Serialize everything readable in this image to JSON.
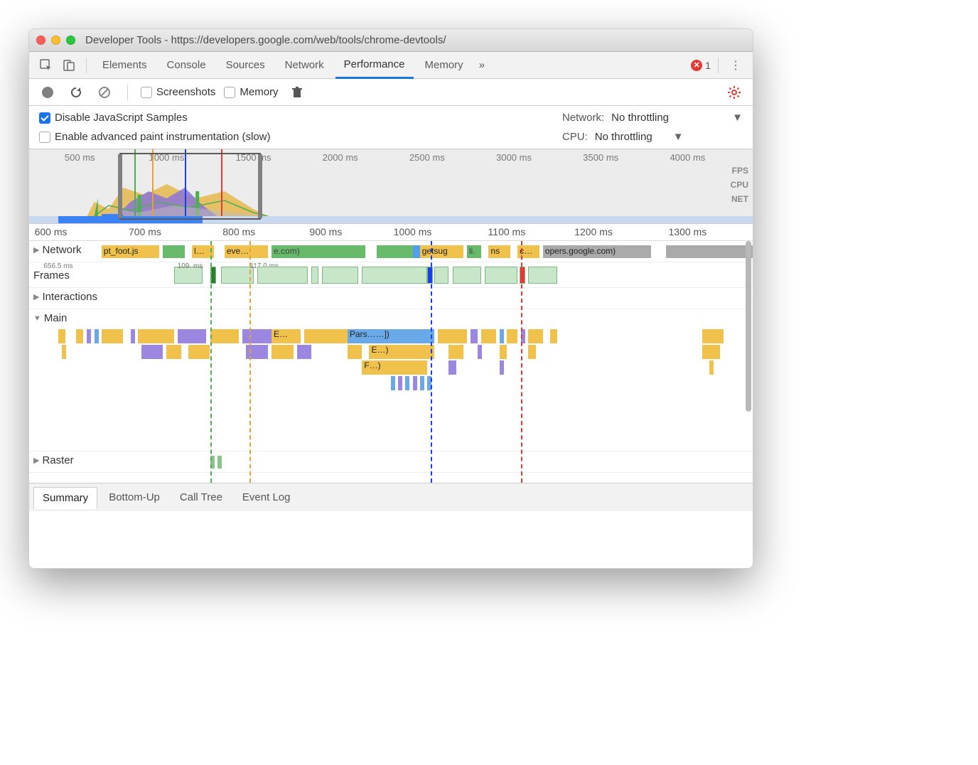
{
  "window": {
    "title": "Developer Tools - https://developers.google.com/web/tools/chrome-devtools/"
  },
  "tabs": {
    "elements": "Elements",
    "console": "Console",
    "sources": "Sources",
    "network": "Network",
    "performance": "Performance",
    "memory": "Memory",
    "active": "Performance",
    "more_glyph": "»",
    "error_count": "1"
  },
  "toolbar": {
    "screenshots": "Screenshots",
    "memory": "Memory"
  },
  "settings": {
    "disable_js_samples": "Disable JavaScript Samples",
    "enable_paint": "Enable advanced paint instrumentation (slow)",
    "network_label": "Network:",
    "network_value": "No throttling",
    "cpu_label": "CPU:",
    "cpu_value": "No throttling"
  },
  "overview": {
    "ticks": [
      "500 ms",
      "1000 ms",
      "1500 ms",
      "2000 ms",
      "2500 ms",
      "3000 ms",
      "3500 ms",
      "4000 ms"
    ],
    "labels": {
      "fps": "FPS",
      "cpu": "CPU",
      "net": "NET"
    }
  },
  "ruler": {
    "ticks": [
      "600 ms",
      "700 ms",
      "800 ms",
      "900 ms",
      "1000 ms",
      "1100 ms",
      "1200 ms",
      "1300 ms"
    ]
  },
  "tracks": {
    "network": "Network",
    "frames": "Frames",
    "interactions": "Interactions",
    "main": "Main",
    "raster": "Raster",
    "net_items": {
      "a": "pt_foot.js",
      "b": "l…",
      "c": "eve…",
      "d": "e.com)",
      "e": "getsug",
      "f": "li.",
      "g": "ns",
      "h": "c…",
      "i": "opers.google.com)"
    },
    "frame_meta": {
      "t0": "656.5 ms",
      "t1": "109. ms",
      "t2": "117.0 ms"
    },
    "main_items": {
      "e": "E…",
      "pars": "Pars……])",
      "e2": "E…)",
      "f": "F…)"
    }
  },
  "bottom_tabs": {
    "summary": "Summary",
    "bottom_up": "Bottom-Up",
    "call_tree": "Call Tree",
    "event_log": "Event Log"
  },
  "colors": {
    "accent": "#1a73e8",
    "error": "#e53935",
    "scripting": "#f0c24b",
    "rendering": "#9b86e0",
    "painting": "#8bc48b",
    "loading": "#6aa9e8"
  }
}
